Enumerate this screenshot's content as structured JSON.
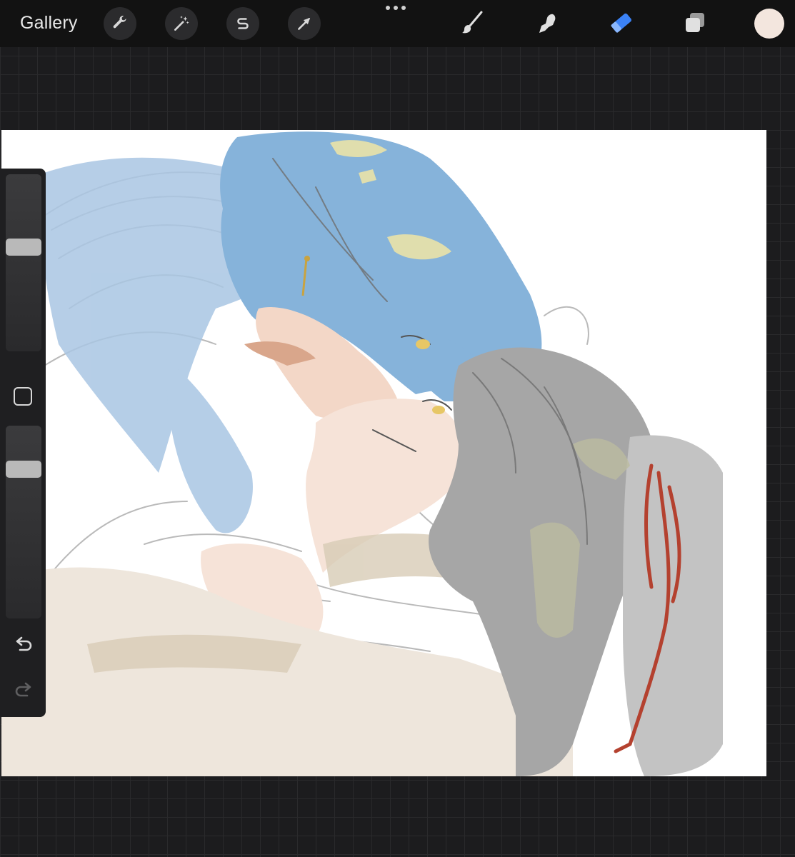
{
  "app": {
    "gallery_label": "Gallery"
  },
  "toolbar_left": [
    {
      "name": "actions-wrench-icon"
    },
    {
      "name": "adjustments-magic-wand-icon"
    },
    {
      "name": "selection-s-icon"
    },
    {
      "name": "transform-arrow-icon"
    }
  ],
  "toolbar_right": [
    {
      "name": "brush-icon",
      "active": false
    },
    {
      "name": "smudge-icon",
      "active": false
    },
    {
      "name": "eraser-icon",
      "active": true
    },
    {
      "name": "layers-icon",
      "active": false
    }
  ],
  "colors": {
    "accent": "#3b82f6",
    "current_color": "#f3e6de",
    "hair_blue": "#8fb8dc",
    "hair_gray": "#a9a9a9",
    "skin": "#f4ddd0",
    "ribbon": "#b4412f"
  },
  "sidebar": {
    "brush_size_level": 0.6,
    "opacity_level": 0.8
  }
}
